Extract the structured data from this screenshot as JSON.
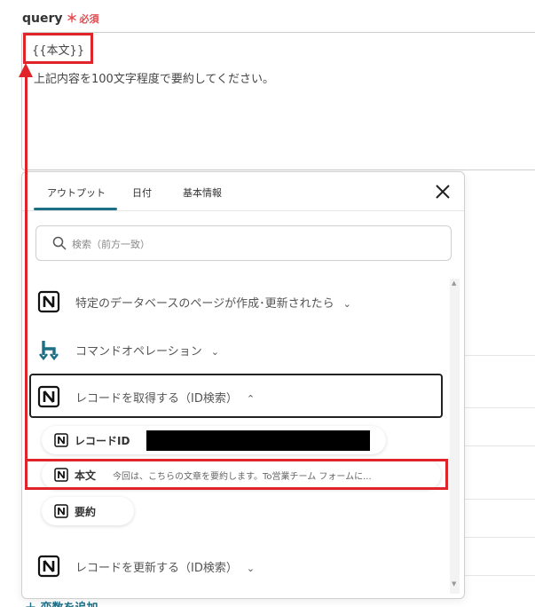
{
  "field": {
    "name": "query",
    "required_star": "＊",
    "required_text": "必須"
  },
  "query": {
    "token": "{{本文}}",
    "line2": "上記内容を100文字程度で要約してください。"
  },
  "popup": {
    "tabs": [
      "アウトプット",
      "日付",
      "基本情報"
    ],
    "search_placeholder": "検索（前方一致）",
    "rows": [
      {
        "label": "特定のデータベースのページが作成･更新されたら",
        "chevron": "⌄",
        "icon": "notion-icon"
      },
      {
        "label": "コマンドオペレーション",
        "chevron": "⌄",
        "icon": "yoom-command-icon"
      },
      {
        "label": "レコードを取得する（ID検索）",
        "chevron": "⌃",
        "icon": "notion-icon"
      },
      {
        "label": "レコードを更新する（ID検索）",
        "chevron": "⌄",
        "icon": "notion-icon"
      }
    ],
    "chips": [
      {
        "label": "レコードID",
        "value": ""
      },
      {
        "label": "本文",
        "value": "今回は、こちらの文章を要約します。To営業チーム フォームに..."
      },
      {
        "label": "要約",
        "value": ""
      }
    ]
  },
  "add_variable": "＋ 変数を追加",
  "colors": {
    "accent": "#1d6f86",
    "highlight": "#e0242a",
    "required": "#e5484d"
  }
}
